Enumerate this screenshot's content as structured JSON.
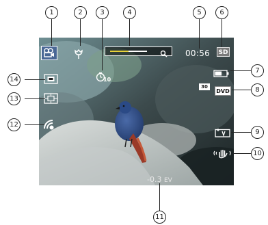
{
  "callouts": [
    "1",
    "2",
    "3",
    "4",
    "5",
    "6",
    "7",
    "8",
    "9",
    "10",
    "11",
    "12",
    "13",
    "14"
  ],
  "osd": {
    "mode_icon": "movie-camera-icon",
    "macro_icon": "macro-flower-icon",
    "self_timer_icon": "self-timer-icon",
    "self_timer_value": "10",
    "zoom_icon": "magnifier-icon",
    "zoom_level": 0.5,
    "recording_time": "00:56",
    "storage": "SD",
    "battery_icon": "battery-icon",
    "battery_level": 0.6,
    "frame_rate": "30",
    "video_format": "DVD",
    "stabilization_icon": "hand-shake-icon",
    "face_detect_icon": "face-detect-icon",
    "metering_icon": "metering-icon",
    "af_icon": "af-frame-icon",
    "wifi_icon": "wifi-icon",
    "exposure_value": "-0.3",
    "exposure_unit": "EV"
  },
  "colors": {
    "accent_yellow": "#e8d23a",
    "overlay": "#ffffff"
  }
}
